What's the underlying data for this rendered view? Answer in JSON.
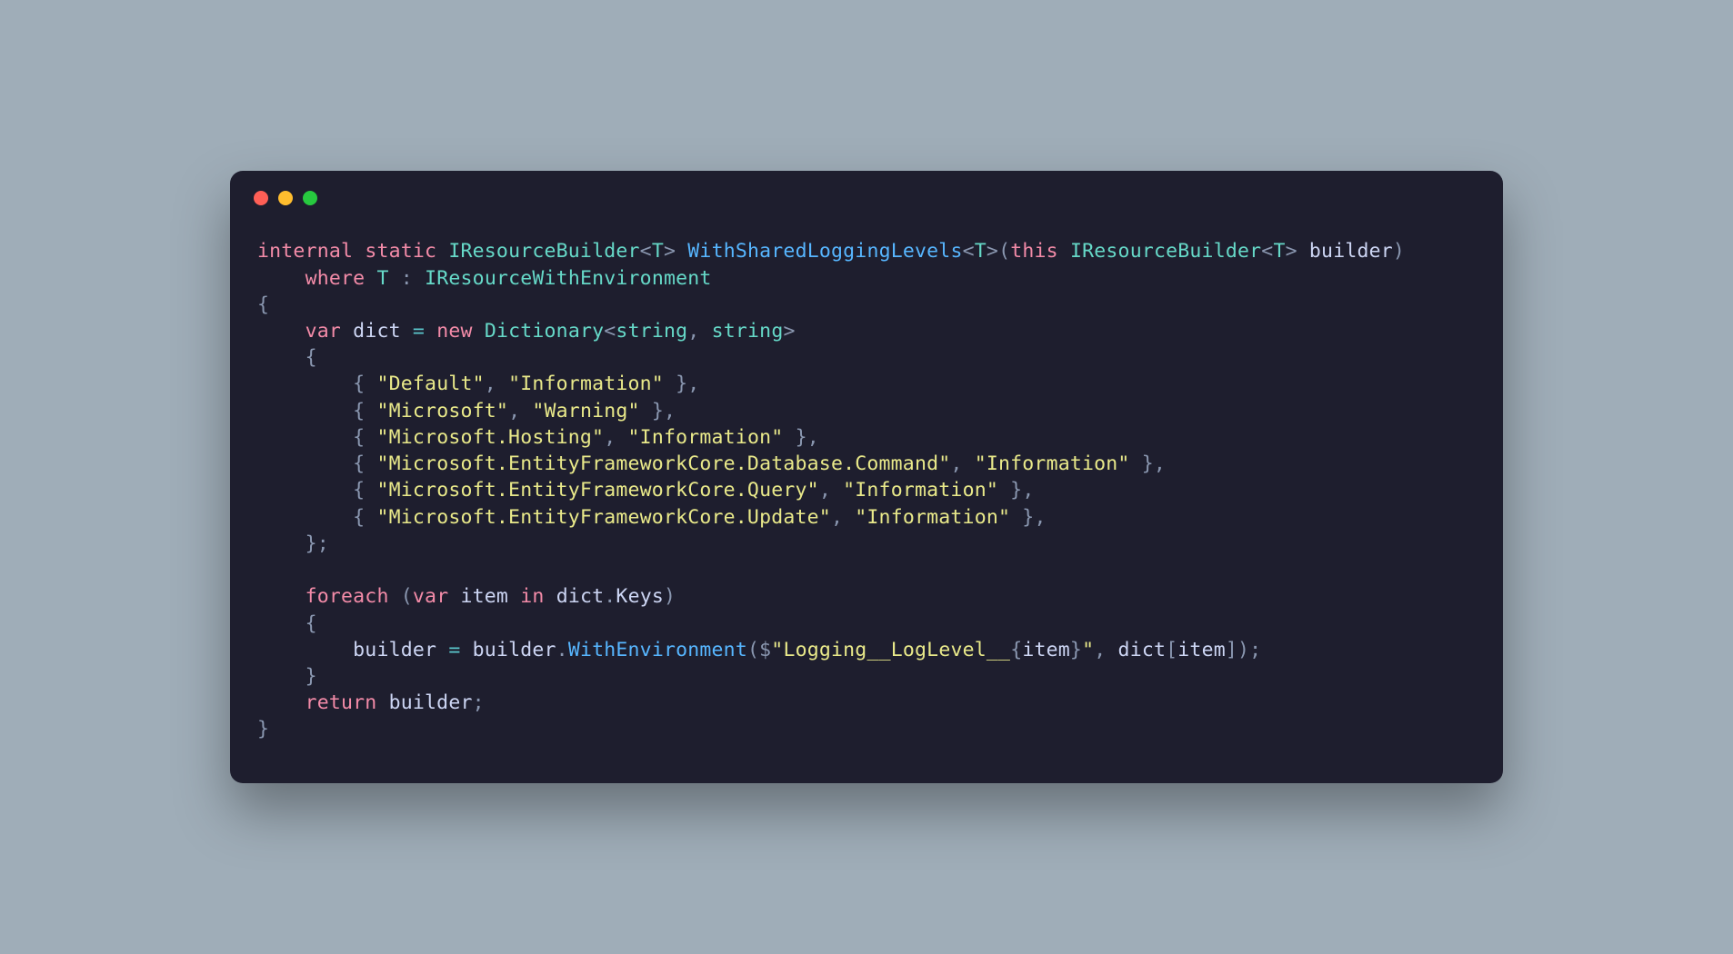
{
  "language": "csharp",
  "indent_unit": "    ",
  "tokens": {
    "internal": "internal",
    "static": "static",
    "where": "where",
    "this": "this",
    "var": "var",
    "new": "new",
    "foreach": "foreach",
    "in": "in",
    "return": "return",
    "IResourceBuilder": "IResourceBuilder",
    "IResourceWithEnvironment": "IResourceWithEnvironment",
    "Dictionary": "Dictionary",
    "T": "T",
    "string": "string",
    "WithSharedLoggingLevels": "WithSharedLoggingLevels",
    "WithEnvironment": "WithEnvironment",
    "builder": "builder",
    "dict": "dict",
    "item": "item",
    "Keys": "Keys",
    "interp_literal": "Logging__LogLevel__"
  },
  "dict_entries": [
    {
      "key": "\"Default\"",
      "value": "\"Information\""
    },
    {
      "key": "\"Microsoft\"",
      "value": "\"Warning\""
    },
    {
      "key": "\"Microsoft.Hosting\"",
      "value": "\"Information\""
    },
    {
      "key": "\"Microsoft.EntityFrameworkCore.Database.Command\"",
      "value": "\"Information\""
    },
    {
      "key": "\"Microsoft.EntityFrameworkCore.Query\"",
      "value": "\"Information\""
    },
    {
      "key": "\"Microsoft.EntityFrameworkCore.Update\"",
      "value": "\"Information\""
    }
  ]
}
